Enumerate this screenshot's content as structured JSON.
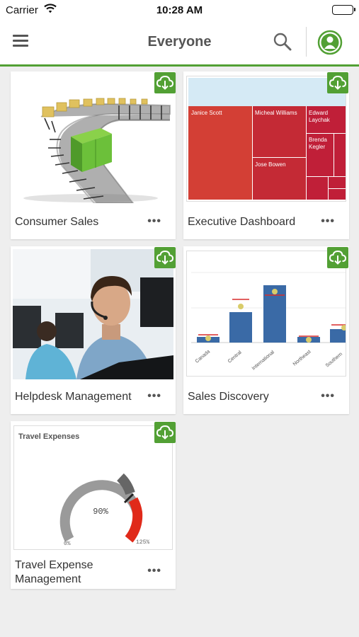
{
  "status": {
    "carrier": "Carrier",
    "time": "10:28 AM"
  },
  "nav": {
    "title": "Everyone"
  },
  "accent": "#52a034",
  "apps": [
    {
      "title": "Consumer Sales",
      "more": "•••"
    },
    {
      "title": "Executive Dashboard",
      "more": "•••",
      "treemap_labels": [
        "Janice Scott",
        "Micheal Williams",
        "Edward Laychak",
        "Brenda Kegler",
        "Jose Bowen"
      ]
    },
    {
      "title": "Helpdesk Management",
      "more": "•••"
    },
    {
      "title": "Sales Discovery",
      "more": "•••",
      "axis_labels": [
        "Canada",
        "Central",
        "International",
        "Northeast",
        "Southern"
      ]
    },
    {
      "title_line1": "Travel Expense",
      "title_line2": "Management",
      "more": "•••",
      "gauge": {
        "title": "Travel Expenses",
        "value_label": "90%",
        "min_label": "0%",
        "max_label": "125%"
      }
    }
  ]
}
